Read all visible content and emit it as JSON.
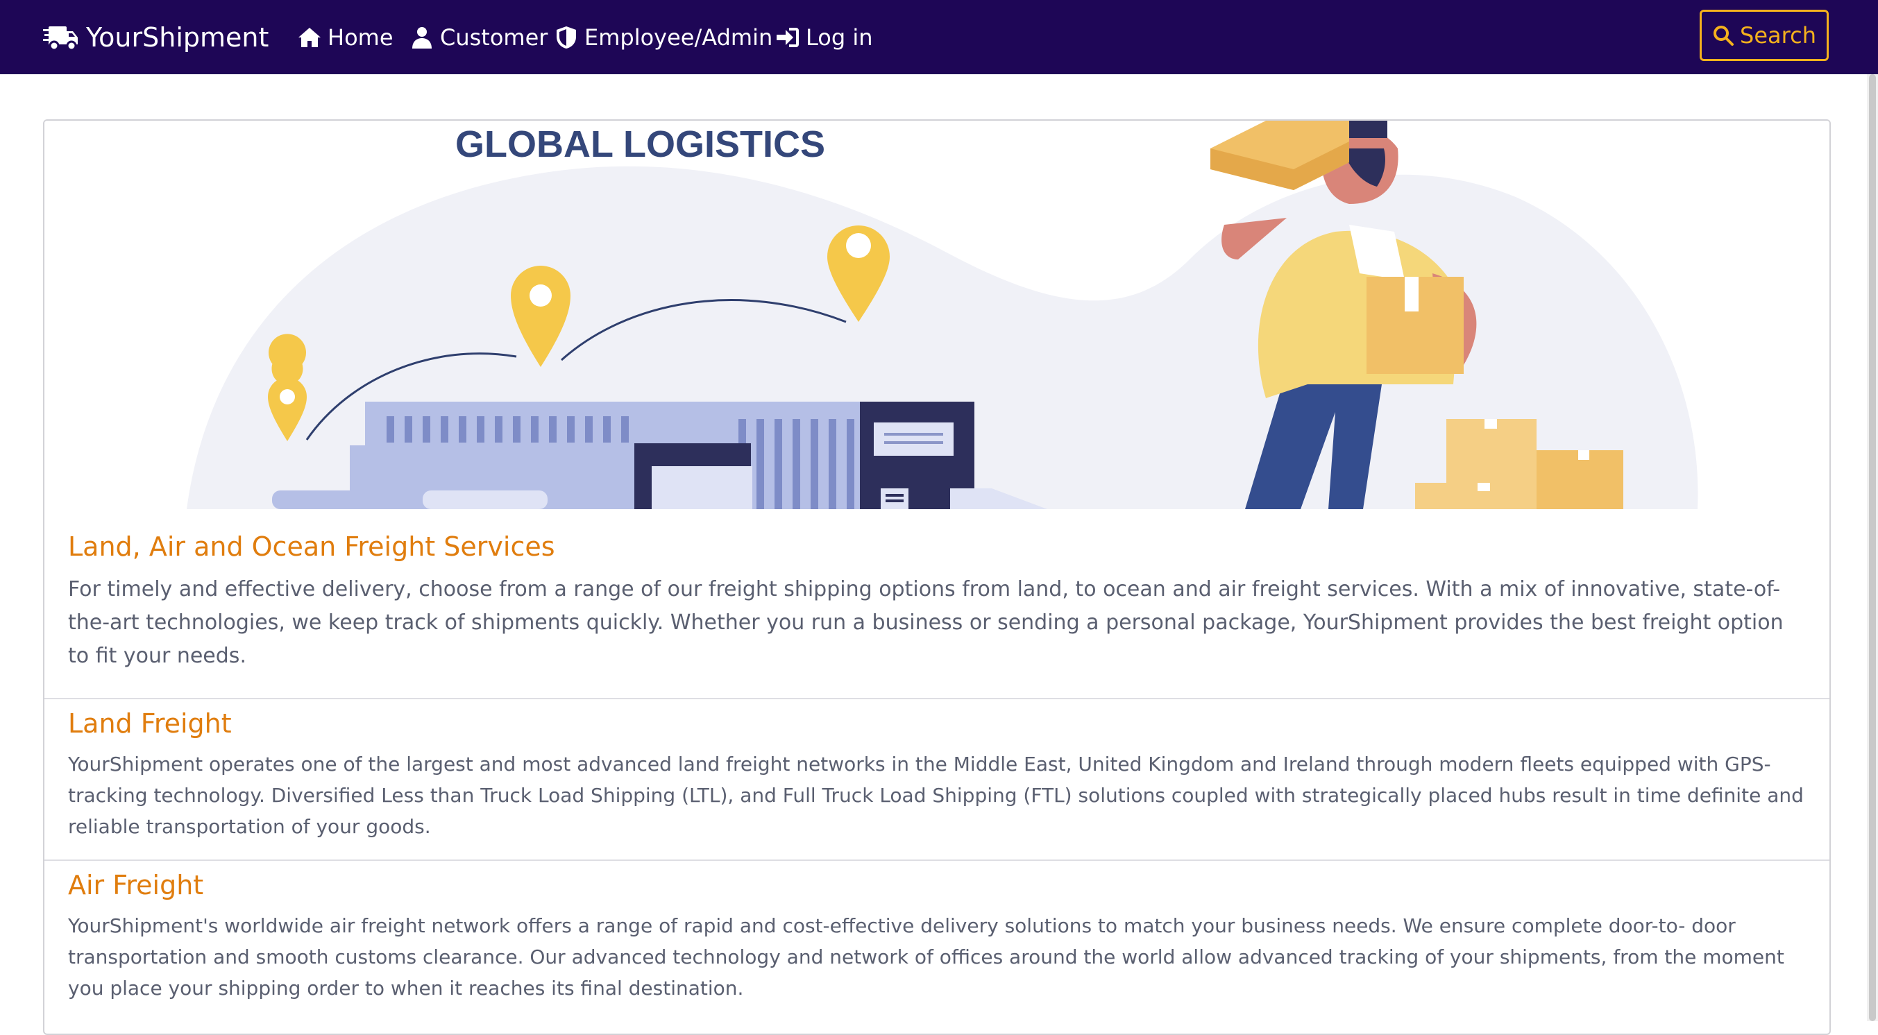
{
  "nav": {
    "brand": "YourShipment",
    "items": [
      {
        "label": "Home",
        "icon": "home-icon"
      },
      {
        "label": "Customer",
        "icon": "user-icon"
      },
      {
        "label": "Employee/Admin",
        "icon": "shield-icon"
      },
      {
        "label": "Log in",
        "icon": "sign-in-icon"
      }
    ],
    "search_label": "Search"
  },
  "hero": {
    "heading": "GLOBAL LOGISTICS"
  },
  "sections": [
    {
      "title": "Land, Air and Ocean Freight Services",
      "text": "For timely and effective delivery, choose from a range of our freight shipping options from land, to ocean and air freight services. With a mix of innovative, state-of-the-art technologies, we keep track of shipments quickly. Whether you run a business or sending a personal package, YourShipment provides the best freight option to fit your needs."
    },
    {
      "title": "Land Freight",
      "text": "YourShipment operates one of the largest and most advanced land freight networks in the Middle East, United Kingdom and Ireland through modern fleets equipped with GPS-tracking technology. Diversified Less than Truck Load Shipping (LTL), and Full Truck Load Shipping (FTL) solutions coupled with strategically placed hubs result in time definite and reliable transportation of your goods."
    },
    {
      "title": "Air Freight",
      "text": "YourShipment's worldwide air freight network offers a range of rapid and cost-effective delivery solutions to match your business needs. We ensure complete door-to- door transportation and smooth customs clearance. Our advanced technology and network of offices around the world allow advanced tracking of your shipments, from the moment you place your shipping order to when it reaches its final destination."
    }
  ],
  "colors": {
    "navbar": "#1e0656",
    "accent": "#f4b11d",
    "section_title": "#e07d0e",
    "body_text": "#5a5f70"
  }
}
